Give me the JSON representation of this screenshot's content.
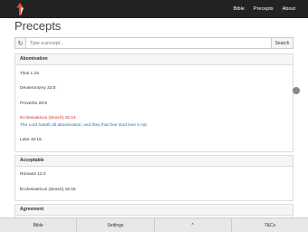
{
  "nav": {
    "links": [
      "Bible",
      "Precepts",
      "About"
    ]
  },
  "page": {
    "title": "Precepts"
  },
  "search": {
    "placeholder": "Type a precept...",
    "button": "Search",
    "refresh_icon": "refresh-icon"
  },
  "panels": [
    {
      "heading": "Abomination",
      "entries": [
        {
          "text": "Titus 1:16",
          "style": "plain"
        },
        {
          "text": "Deuteronomy 22:5",
          "style": "plain"
        },
        {
          "text": "Proverbs 28:9",
          "style": "plain"
        },
        {
          "text": "Ecclesiasticus (Sirach) 15:13",
          "style": "red"
        },
        {
          "text": "The Lord hateth all abomination; and they that fear God love it not.",
          "style": "blue"
        },
        {
          "text": "Luke 16:15",
          "style": "plain"
        }
      ]
    },
    {
      "heading": "Acceptable",
      "entries": [
        {
          "text": "Romans 12:2",
          "style": "plain"
        },
        {
          "text": "Ecclesiasticus (Sirach) 15:15",
          "style": "plain"
        }
      ]
    },
    {
      "heading": "Agreement",
      "entries": []
    }
  ],
  "bottom": {
    "tabs": [
      "Bible",
      "Settings",
      "^",
      "T&Cs"
    ]
  }
}
